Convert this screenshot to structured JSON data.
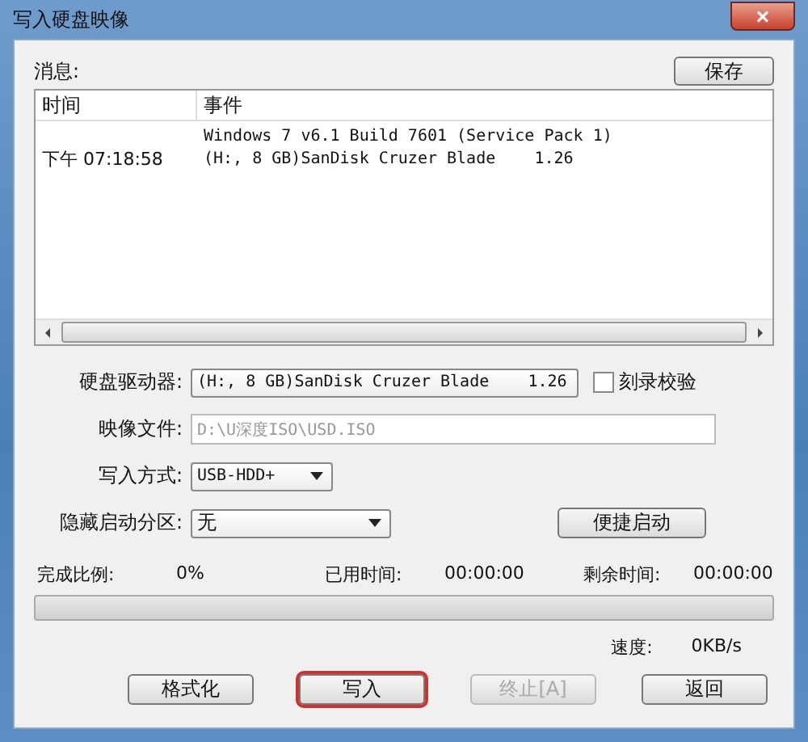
{
  "window": {
    "title": "写入硬盘映像",
    "close": "×"
  },
  "messages": {
    "label": "消息:",
    "save_button": "保存",
    "columns": [
      "时间",
      "事件"
    ],
    "rows": [
      {
        "time": "",
        "event": "Windows 7 v6.1 Build 7601 (Service Pack 1)"
      },
      {
        "time": "下午 07:18:58",
        "event": "(H:, 8 GB)SanDisk Cruzer Blade    1.26"
      }
    ]
  },
  "form": {
    "drive_label": "硬盘驱动器:",
    "drive_value": "(H:, 8 GB)SanDisk Cruzer Blade    1.26",
    "verify_label": "刻录校验",
    "verify_checked": false,
    "image_label": "映像文件:",
    "image_value": "D:\\U深度ISO\\USD.ISO",
    "method_label": "写入方式:",
    "method_value": "USB-HDD+",
    "hidden_label": "隐藏启动分区:",
    "hidden_value": "无",
    "quick_boot_button": "便捷启动"
  },
  "progress": {
    "percent_label": "完成比例:",
    "percent_value": "0%",
    "elapsed_label": "已用时间:",
    "elapsed_value": "00:00:00",
    "remaining_label": "剩余时间:",
    "remaining_value": "00:00:00",
    "level": 0,
    "speed_label": "速度:",
    "speed_value": "0KB/s"
  },
  "buttons": [
    {
      "label": "格式化",
      "disabled": false,
      "highlighted": false
    },
    {
      "label": "写入",
      "disabled": false,
      "highlighted": true
    },
    {
      "label": "终止[A]",
      "disabled": true,
      "highlighted": false
    },
    {
      "label": "返回",
      "disabled": false,
      "highlighted": false
    }
  ]
}
